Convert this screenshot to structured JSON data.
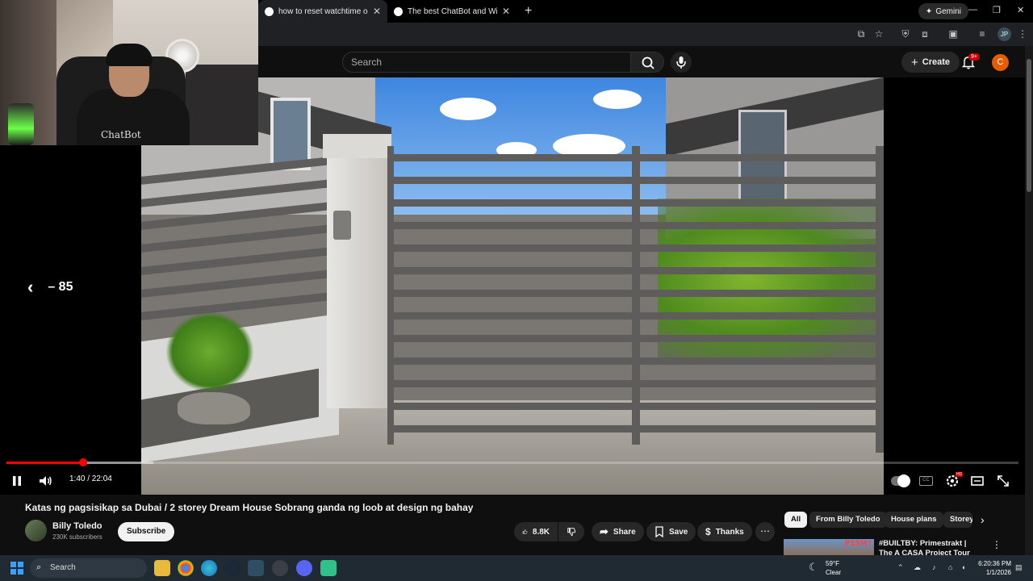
{
  "browser": {
    "tabs": [
      {
        "title": "how to reset watchtime on bot",
        "active": true
      },
      {
        "title": "The best ChatBot and Widgets",
        "active": false
      }
    ],
    "new_tab": "+",
    "gemini_label": "Gemini",
    "profile_initials": "JP"
  },
  "webcam": {
    "shirt_text": "ChatBot"
  },
  "youtube": {
    "search_placeholder": "Search",
    "create_label": "Create",
    "notif_count": "9+",
    "account_initial": "C"
  },
  "player": {
    "seek_label": "– 85",
    "current_time": "1:40",
    "duration": "22:04",
    "time_display": "1:40 / 22:04",
    "progress_fraction": 0.0755,
    "buffered_fraction": 0.145,
    "hd_badge": "HD"
  },
  "video": {
    "title": "Katas ng pagsisikap sa Dubai / 2 storey Dream House Sobrang ganda ng loob at design ng bahay",
    "channel": "Billy Toledo",
    "subscribers": "230K subscribers",
    "subscribe_label": "Subscribe",
    "likes": "8.8K",
    "share_label": "Share",
    "save_label": "Save",
    "thanks_label": "Thanks",
    "more_label": "⋯"
  },
  "sidebar": {
    "chips": [
      "All",
      "From Billy Toledo",
      "House plans",
      "Storey"
    ],
    "recommendation": {
      "price_tag": "P15M?",
      "title": "#BUILTBY: Primestrakt | The A CASA Project Tour"
    }
  },
  "taskbar": {
    "search_label": "Search",
    "weather_temp": "59°F",
    "weather_desc": "Clear",
    "time": "6:20:36 PM",
    "date": "1/1/2026"
  },
  "colors": {
    "yt_red": "#ff0000",
    "bg": "#0f0f0f",
    "avatar_orange": "#e65c00"
  }
}
